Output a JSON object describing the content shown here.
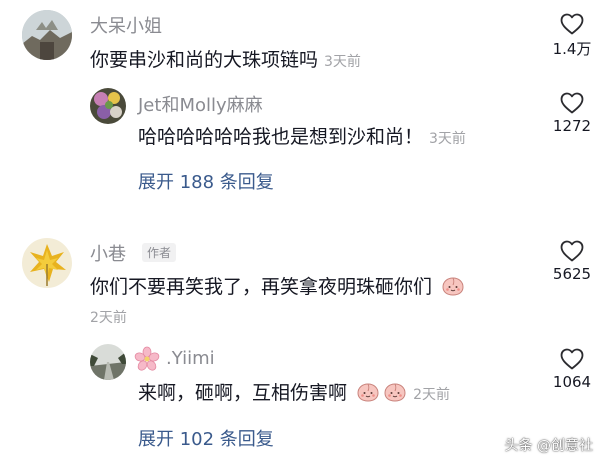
{
  "comments": [
    {
      "username": "大呆小姐",
      "text": "你要串沙和尚的大珠项链吗",
      "time": "3天前",
      "likes": "1.4万",
      "reply": {
        "username": "Jet和Molly麻麻",
        "text": "哈哈哈哈哈哈我也是想到沙和尚！",
        "time": "3天前",
        "likes": "1272"
      },
      "expand_label": "展开 188 条回复"
    },
    {
      "username": "小巷",
      "author_tag": "作者",
      "text": "你们不要再笑我了，再笑拿夜明珠砸你们",
      "time": "2天前",
      "likes": "5625",
      "reply": {
        "username": ".Yiimi",
        "text": "来啊，砸啊，互相伤害啊",
        "time": "2天前",
        "likes": "1064"
      },
      "expand_label": "展开 102 条回复"
    }
  ],
  "watermark": "头条 @创意社",
  "colors": {
    "link_blue": "#3a5a8c",
    "username_gray": "#8a8b91",
    "time_gray": "#a2a3a7",
    "text_dark": "#161823"
  },
  "icons": {
    "like": "heart-outline-icon",
    "emoji": "peach-face-emoji-icon"
  }
}
